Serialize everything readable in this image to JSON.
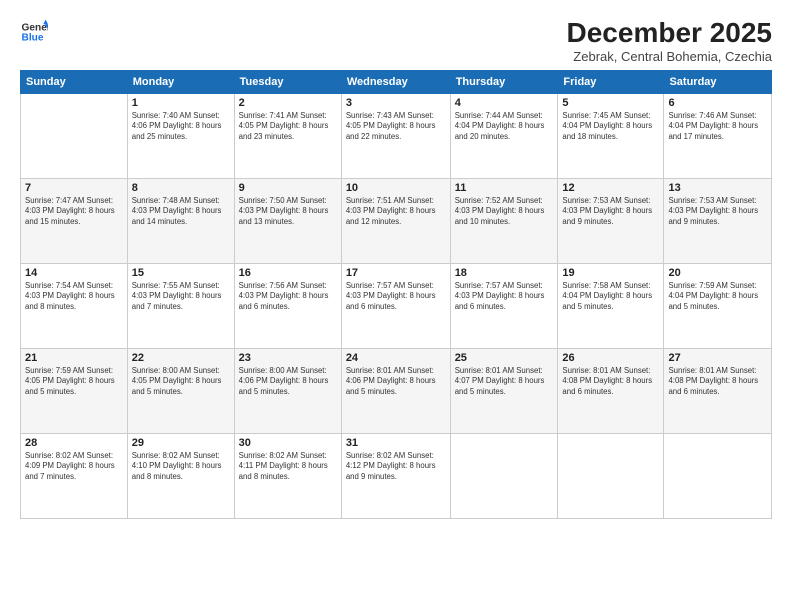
{
  "logo": {
    "line1": "General",
    "line2": "Blue"
  },
  "title": "December 2025",
  "location": "Zebrak, Central Bohemia, Czechia",
  "days_of_week": [
    "Sunday",
    "Monday",
    "Tuesday",
    "Wednesday",
    "Thursday",
    "Friday",
    "Saturday"
  ],
  "weeks": [
    [
      {
        "day": "",
        "info": ""
      },
      {
        "day": "1",
        "info": "Sunrise: 7:40 AM\nSunset: 4:06 PM\nDaylight: 8 hours\nand 25 minutes."
      },
      {
        "day": "2",
        "info": "Sunrise: 7:41 AM\nSunset: 4:05 PM\nDaylight: 8 hours\nand 23 minutes."
      },
      {
        "day": "3",
        "info": "Sunrise: 7:43 AM\nSunset: 4:05 PM\nDaylight: 8 hours\nand 22 minutes."
      },
      {
        "day": "4",
        "info": "Sunrise: 7:44 AM\nSunset: 4:04 PM\nDaylight: 8 hours\nand 20 minutes."
      },
      {
        "day": "5",
        "info": "Sunrise: 7:45 AM\nSunset: 4:04 PM\nDaylight: 8 hours\nand 18 minutes."
      },
      {
        "day": "6",
        "info": "Sunrise: 7:46 AM\nSunset: 4:04 PM\nDaylight: 8 hours\nand 17 minutes."
      }
    ],
    [
      {
        "day": "7",
        "info": "Sunrise: 7:47 AM\nSunset: 4:03 PM\nDaylight: 8 hours\nand 15 minutes."
      },
      {
        "day": "8",
        "info": "Sunrise: 7:48 AM\nSunset: 4:03 PM\nDaylight: 8 hours\nand 14 minutes."
      },
      {
        "day": "9",
        "info": "Sunrise: 7:50 AM\nSunset: 4:03 PM\nDaylight: 8 hours\nand 13 minutes."
      },
      {
        "day": "10",
        "info": "Sunrise: 7:51 AM\nSunset: 4:03 PM\nDaylight: 8 hours\nand 12 minutes."
      },
      {
        "day": "11",
        "info": "Sunrise: 7:52 AM\nSunset: 4:03 PM\nDaylight: 8 hours\nand 10 minutes."
      },
      {
        "day": "12",
        "info": "Sunrise: 7:53 AM\nSunset: 4:03 PM\nDaylight: 8 hours\nand 9 minutes."
      },
      {
        "day": "13",
        "info": "Sunrise: 7:53 AM\nSunset: 4:03 PM\nDaylight: 8 hours\nand 9 minutes."
      }
    ],
    [
      {
        "day": "14",
        "info": "Sunrise: 7:54 AM\nSunset: 4:03 PM\nDaylight: 8 hours\nand 8 minutes."
      },
      {
        "day": "15",
        "info": "Sunrise: 7:55 AM\nSunset: 4:03 PM\nDaylight: 8 hours\nand 7 minutes."
      },
      {
        "day": "16",
        "info": "Sunrise: 7:56 AM\nSunset: 4:03 PM\nDaylight: 8 hours\nand 6 minutes."
      },
      {
        "day": "17",
        "info": "Sunrise: 7:57 AM\nSunset: 4:03 PM\nDaylight: 8 hours\nand 6 minutes."
      },
      {
        "day": "18",
        "info": "Sunrise: 7:57 AM\nSunset: 4:03 PM\nDaylight: 8 hours\nand 6 minutes."
      },
      {
        "day": "19",
        "info": "Sunrise: 7:58 AM\nSunset: 4:04 PM\nDaylight: 8 hours\nand 5 minutes."
      },
      {
        "day": "20",
        "info": "Sunrise: 7:59 AM\nSunset: 4:04 PM\nDaylight: 8 hours\nand 5 minutes."
      }
    ],
    [
      {
        "day": "21",
        "info": "Sunrise: 7:59 AM\nSunset: 4:05 PM\nDaylight: 8 hours\nand 5 minutes."
      },
      {
        "day": "22",
        "info": "Sunrise: 8:00 AM\nSunset: 4:05 PM\nDaylight: 8 hours\nand 5 minutes."
      },
      {
        "day": "23",
        "info": "Sunrise: 8:00 AM\nSunset: 4:06 PM\nDaylight: 8 hours\nand 5 minutes."
      },
      {
        "day": "24",
        "info": "Sunrise: 8:01 AM\nSunset: 4:06 PM\nDaylight: 8 hours\nand 5 minutes."
      },
      {
        "day": "25",
        "info": "Sunrise: 8:01 AM\nSunset: 4:07 PM\nDaylight: 8 hours\nand 5 minutes."
      },
      {
        "day": "26",
        "info": "Sunrise: 8:01 AM\nSunset: 4:08 PM\nDaylight: 8 hours\nand 6 minutes."
      },
      {
        "day": "27",
        "info": "Sunrise: 8:01 AM\nSunset: 4:08 PM\nDaylight: 8 hours\nand 6 minutes."
      }
    ],
    [
      {
        "day": "28",
        "info": "Sunrise: 8:02 AM\nSunset: 4:09 PM\nDaylight: 8 hours\nand 7 minutes."
      },
      {
        "day": "29",
        "info": "Sunrise: 8:02 AM\nSunset: 4:10 PM\nDaylight: 8 hours\nand 8 minutes."
      },
      {
        "day": "30",
        "info": "Sunrise: 8:02 AM\nSunset: 4:11 PM\nDaylight: 8 hours\nand 8 minutes."
      },
      {
        "day": "31",
        "info": "Sunrise: 8:02 AM\nSunset: 4:12 PM\nDaylight: 8 hours\nand 9 minutes."
      },
      {
        "day": "",
        "info": ""
      },
      {
        "day": "",
        "info": ""
      },
      {
        "day": "",
        "info": ""
      }
    ]
  ]
}
